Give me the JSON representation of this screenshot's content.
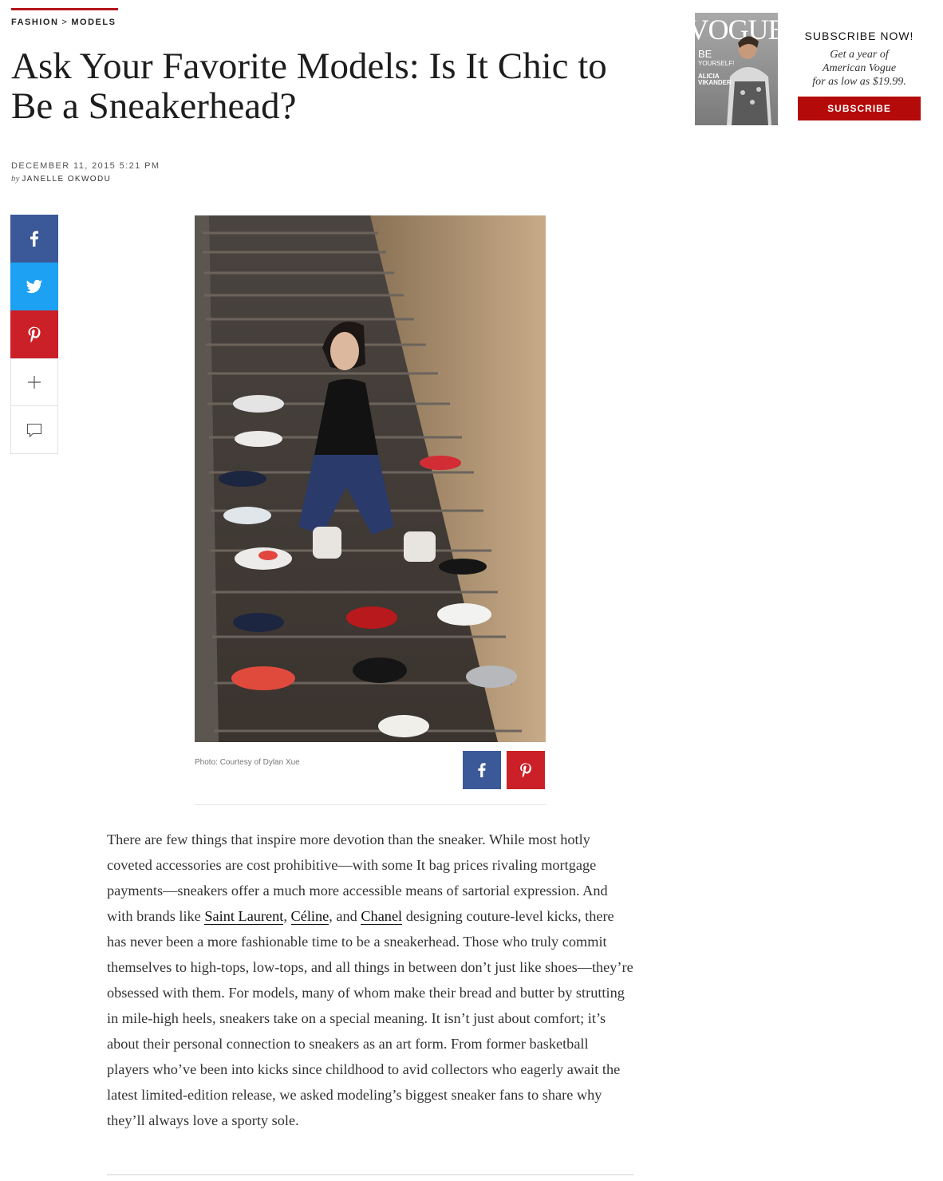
{
  "breadcrumb": {
    "section": "FASHION",
    "separator": ">",
    "subsection": "MODELS"
  },
  "article": {
    "title": "Ask Your Favorite Models: Is It Chic to Be a Sneakerhead?",
    "date": "DECEMBER 11, 2015 5:21 PM",
    "byline_prefix": "by",
    "author": "JANELLE OKWODU",
    "photo_credit": "Photo: Courtesy of Dylan Xue",
    "body_1": "There are few things that inspire more devotion than the sneaker. While most hotly coveted accessories are cost prohibitive—with some It bag prices rivaling mortgage payments—sneakers offer a much more accessible means of sartorial expression. And with brands like ",
    "link_1": "Saint Laurent",
    "sep_1": ", ",
    "link_2": "Céline",
    "sep_2": ", and ",
    "link_3": "Chanel",
    "body_2": " designing couture-level kicks, there has never been a more fashionable time to be a sneakerhead. Those who truly commit themselves to high-tops, low-tops, and all things in between don’t just like shoes—they’re obsessed with them. For models, many of whom make their bread and butter by strutting in mile-high heels, sneakers take on a special meaning. It isn’t just about comfort; it’s about their personal connection to sneakers as an art form. From former basketball players who’ve been into kicks since childhood to avid collectors who eagerly await the latest limited-edition release, we asked modeling’s biggest sneaker fans to share why they’ll always love a sporty sole."
  },
  "promo": {
    "heading": "SUBSCRIBE NOW!",
    "line1": "Get a year of",
    "line2": "American Vogue",
    "line3": "for as low as $19.99.",
    "button": "SUBSCRIBE",
    "cover": {
      "masthead": "VOGUE",
      "cover_line_1": "BE",
      "cover_line_2": "YOURSELF!",
      "cover_line_3": "ALICIA",
      "cover_line_4": "VIKANDER"
    }
  },
  "share": {
    "rail": [
      "facebook-icon",
      "twitter-icon",
      "pinterest-icon",
      "plus-icon",
      "comment-icon"
    ],
    "image": [
      "facebook-icon",
      "pinterest-icon"
    ]
  },
  "colors": {
    "accent_red": "#b3161c",
    "subscribe_red": "#b40a0a",
    "facebook": "#3b5998",
    "twitter": "#1da1f2",
    "pinterest": "#cb2027"
  }
}
